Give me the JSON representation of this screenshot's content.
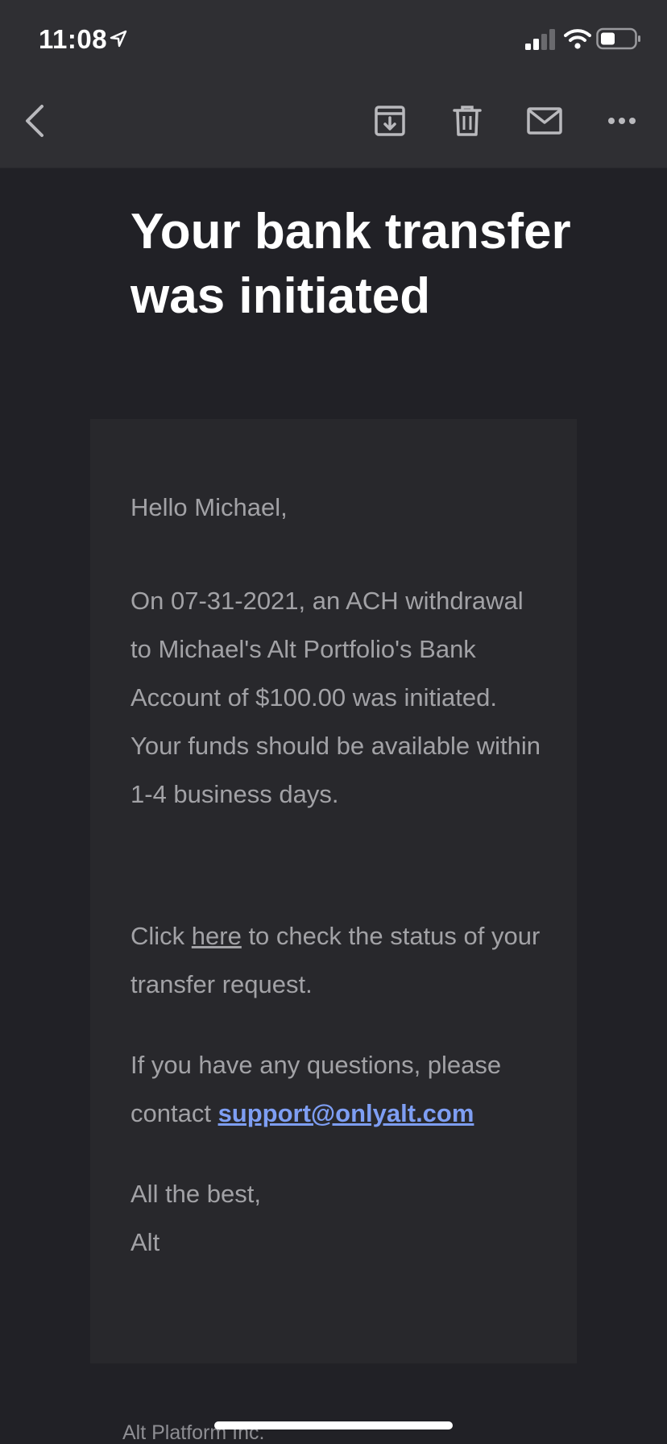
{
  "status_bar": {
    "time": "11:08"
  },
  "toolbar": {
    "icons": [
      "back-chevron-icon",
      "archive-icon",
      "trash-icon",
      "mail-icon",
      "more-icon"
    ]
  },
  "email": {
    "headline": "Your bank transfer was initiated",
    "greeting": "Hello Michael,",
    "body": "On 07-31-2021, an ACH withdrawal to Michael's Alt Portfolio's Bank Account of $100.00 was initiated. Your funds should be available within 1-4 business days.",
    "status_prefix": "Click ",
    "status_link": "here",
    "status_suffix": " to check the status of your transfer request.",
    "questions_prefix": "If you have any questions, please contact ",
    "support_email": "support@onlyalt.com",
    "signoff": "All the best,",
    "signature": "Alt",
    "footer_company": "Alt Platform Inc."
  },
  "colors": {
    "background": "#212126",
    "toolbar": "#2f2f33",
    "card": "#28282c",
    "body_text": "#a2a2a6",
    "link": "#7e9ef3",
    "headline": "#ffffff"
  }
}
